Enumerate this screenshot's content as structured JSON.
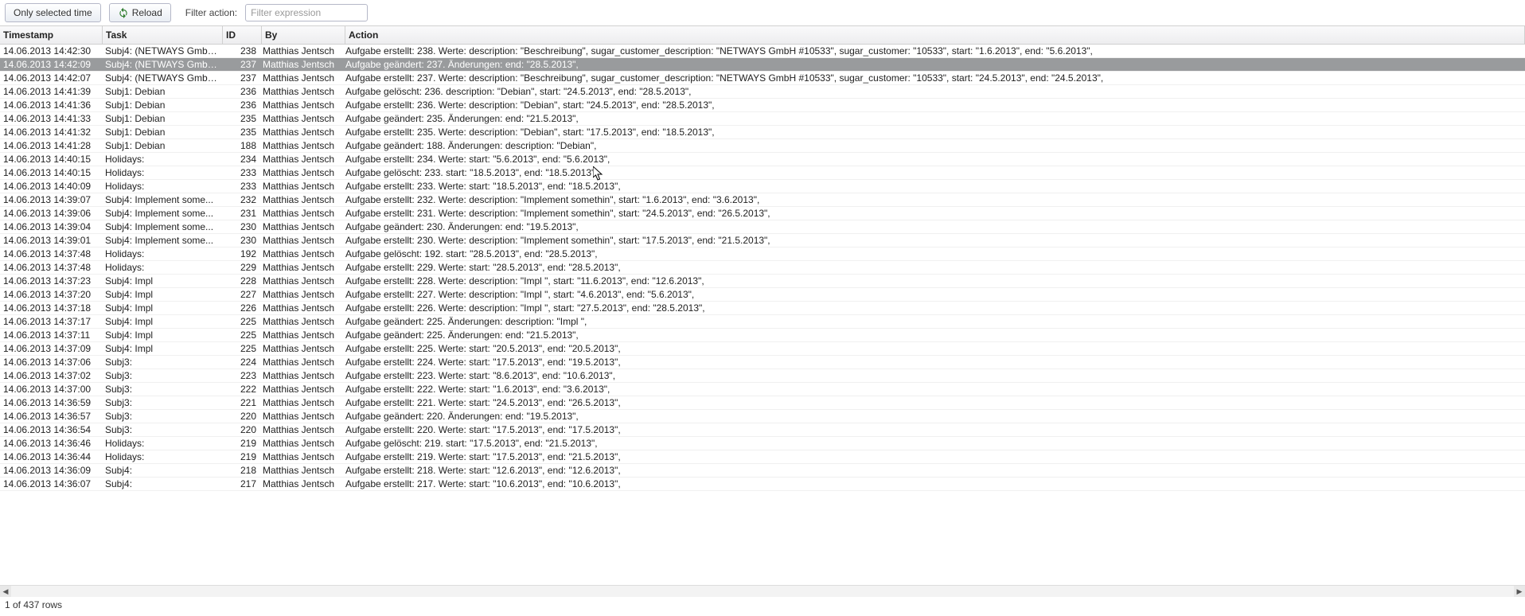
{
  "toolbar": {
    "only_selected_time_label": "Only selected time",
    "reload_label": "Reload",
    "filter_label": "Filter action:",
    "filter_placeholder": "Filter expression"
  },
  "columns": {
    "timestamp": "Timestamp",
    "task": "Task",
    "id": "ID",
    "by": "By",
    "action": "Action"
  },
  "status": {
    "text": "1 of 437 rows"
  },
  "selected_index": 1,
  "rows": [
    {
      "ts": "14.06.2013 14:42:30",
      "task": "Subj4: (NETWAYS GmbH...",
      "id": "238",
      "by": "Matthias Jentsch",
      "action": "Aufgabe erstellt: 238. Werte: description: \"Beschreibung\", sugar_customer_description: \"NETWAYS GmbH #10533\", sugar_customer: \"10533\", start: \"1.6.2013\", end: \"5.6.2013\","
    },
    {
      "ts": "14.06.2013 14:42:09",
      "task": "Subj4: (NETWAYS GmbH...",
      "id": "237",
      "by": "Matthias Jentsch",
      "action": "Aufgabe geändert: 237. Änderungen: end: \"28.5.2013\","
    },
    {
      "ts": "14.06.2013 14:42:07",
      "task": "Subj4: (NETWAYS GmbH...",
      "id": "237",
      "by": "Matthias Jentsch",
      "action": "Aufgabe erstellt: 237. Werte: description: \"Beschreibung\", sugar_customer_description: \"NETWAYS GmbH #10533\", sugar_customer: \"10533\", start: \"24.5.2013\", end: \"24.5.2013\","
    },
    {
      "ts": "14.06.2013 14:41:39",
      "task": "Subj1: Debian",
      "id": "236",
      "by": "Matthias Jentsch",
      "action": "Aufgabe gelöscht: 236. description: \"Debian\", start: \"24.5.2013\", end: \"28.5.2013\","
    },
    {
      "ts": "14.06.2013 14:41:36",
      "task": "Subj1: Debian",
      "id": "236",
      "by": "Matthias Jentsch",
      "action": "Aufgabe erstellt: 236. Werte: description: \"Debian\", start: \"24.5.2013\", end: \"28.5.2013\","
    },
    {
      "ts": "14.06.2013 14:41:33",
      "task": "Subj1: Debian",
      "id": "235",
      "by": "Matthias Jentsch",
      "action": "Aufgabe geändert: 235. Änderungen: end: \"21.5.2013\","
    },
    {
      "ts": "14.06.2013 14:41:32",
      "task": "Subj1: Debian",
      "id": "235",
      "by": "Matthias Jentsch",
      "action": "Aufgabe erstellt: 235. Werte: description: \"Debian\", start: \"17.5.2013\", end: \"18.5.2013\","
    },
    {
      "ts": "14.06.2013 14:41:28",
      "task": "Subj1: Debian",
      "id": "188",
      "by": "Matthias Jentsch",
      "action": "Aufgabe geändert: 188. Änderungen: description: \"Debian\","
    },
    {
      "ts": "14.06.2013 14:40:15",
      "task": "Holidays:",
      "id": "234",
      "by": "Matthias Jentsch",
      "action": "Aufgabe erstellt: 234. Werte: start: \"5.6.2013\", end: \"5.6.2013\","
    },
    {
      "ts": "14.06.2013 14:40:15",
      "task": "Holidays:",
      "id": "233",
      "by": "Matthias Jentsch",
      "action": "Aufgabe gelöscht: 233. start: \"18.5.2013\", end: \"18.5.2013\","
    },
    {
      "ts": "14.06.2013 14:40:09",
      "task": "Holidays:",
      "id": "233",
      "by": "Matthias Jentsch",
      "action": "Aufgabe erstellt: 233. Werte: start: \"18.5.2013\", end: \"18.5.2013\","
    },
    {
      "ts": "14.06.2013 14:39:07",
      "task": "Subj4: Implement some...",
      "id": "232",
      "by": "Matthias Jentsch",
      "action": "Aufgabe erstellt: 232. Werte: description: \"Implement somethin\", start: \"1.6.2013\", end: \"3.6.2013\","
    },
    {
      "ts": "14.06.2013 14:39:06",
      "task": "Subj4: Implement some...",
      "id": "231",
      "by": "Matthias Jentsch",
      "action": "Aufgabe erstellt: 231. Werte: description: \"Implement somethin\", start: \"24.5.2013\", end: \"26.5.2013\","
    },
    {
      "ts": "14.06.2013 14:39:04",
      "task": "Subj4: Implement some...",
      "id": "230",
      "by": "Matthias Jentsch",
      "action": "Aufgabe geändert: 230. Änderungen: end: \"19.5.2013\","
    },
    {
      "ts": "14.06.2013 14:39:01",
      "task": "Subj4: Implement some...",
      "id": "230",
      "by": "Matthias Jentsch",
      "action": "Aufgabe erstellt: 230. Werte: description: \"Implement somethin\", start: \"17.5.2013\", end: \"21.5.2013\","
    },
    {
      "ts": "14.06.2013 14:37:48",
      "task": "Holidays:",
      "id": "192",
      "by": "Matthias Jentsch",
      "action": "Aufgabe gelöscht: 192. start: \"28.5.2013\", end: \"28.5.2013\","
    },
    {
      "ts": "14.06.2013 14:37:48",
      "task": "Holidays:",
      "id": "229",
      "by": "Matthias Jentsch",
      "action": "Aufgabe erstellt: 229. Werte: start: \"28.5.2013\", end: \"28.5.2013\","
    },
    {
      "ts": "14.06.2013 14:37:23",
      "task": "Subj4: Impl",
      "id": "228",
      "by": "Matthias Jentsch",
      "action": "Aufgabe erstellt: 228. Werte: description: \"Impl \", start: \"11.6.2013\", end: \"12.6.2013\","
    },
    {
      "ts": "14.06.2013 14:37:20",
      "task": "Subj4: Impl",
      "id": "227",
      "by": "Matthias Jentsch",
      "action": "Aufgabe erstellt: 227. Werte: description: \"Impl \", start: \"4.6.2013\", end: \"5.6.2013\","
    },
    {
      "ts": "14.06.2013 14:37:18",
      "task": "Subj4: Impl",
      "id": "226",
      "by": "Matthias Jentsch",
      "action": "Aufgabe erstellt: 226. Werte: description: \"Impl \", start: \"27.5.2013\", end: \"28.5.2013\","
    },
    {
      "ts": "14.06.2013 14:37:17",
      "task": "Subj4: Impl",
      "id": "225",
      "by": "Matthias Jentsch",
      "action": "Aufgabe geändert: 225. Änderungen: description: \"Impl \","
    },
    {
      "ts": "14.06.2013 14:37:11",
      "task": "Subj4: Impl",
      "id": "225",
      "by": "Matthias Jentsch",
      "action": "Aufgabe geändert: 225. Änderungen: end: \"21.5.2013\","
    },
    {
      "ts": "14.06.2013 14:37:09",
      "task": "Subj4: Impl",
      "id": "225",
      "by": "Matthias Jentsch",
      "action": "Aufgabe erstellt: 225. Werte: start: \"20.5.2013\", end: \"20.5.2013\","
    },
    {
      "ts": "14.06.2013 14:37:06",
      "task": "Subj3:",
      "id": "224",
      "by": "Matthias Jentsch",
      "action": "Aufgabe erstellt: 224. Werte: start: \"17.5.2013\", end: \"19.5.2013\","
    },
    {
      "ts": "14.06.2013 14:37:02",
      "task": "Subj3:",
      "id": "223",
      "by": "Matthias Jentsch",
      "action": "Aufgabe erstellt: 223. Werte: start: \"8.6.2013\", end: \"10.6.2013\","
    },
    {
      "ts": "14.06.2013 14:37:00",
      "task": "Subj3:",
      "id": "222",
      "by": "Matthias Jentsch",
      "action": "Aufgabe erstellt: 222. Werte: start: \"1.6.2013\", end: \"3.6.2013\","
    },
    {
      "ts": "14.06.2013 14:36:59",
      "task": "Subj3:",
      "id": "221",
      "by": "Matthias Jentsch",
      "action": "Aufgabe erstellt: 221. Werte: start: \"24.5.2013\", end: \"26.5.2013\","
    },
    {
      "ts": "14.06.2013 14:36:57",
      "task": "Subj3:",
      "id": "220",
      "by": "Matthias Jentsch",
      "action": "Aufgabe geändert: 220. Änderungen: end: \"19.5.2013\","
    },
    {
      "ts": "14.06.2013 14:36:54",
      "task": "Subj3:",
      "id": "220",
      "by": "Matthias Jentsch",
      "action": "Aufgabe erstellt: 220. Werte: start: \"17.5.2013\", end: \"17.5.2013\","
    },
    {
      "ts": "14.06.2013 14:36:46",
      "task": "Holidays:",
      "id": "219",
      "by": "Matthias Jentsch",
      "action": "Aufgabe gelöscht: 219. start: \"17.5.2013\", end: \"21.5.2013\","
    },
    {
      "ts": "14.06.2013 14:36:44",
      "task": "Holidays:",
      "id": "219",
      "by": "Matthias Jentsch",
      "action": "Aufgabe erstellt: 219. Werte: start: \"17.5.2013\", end: \"21.5.2013\","
    },
    {
      "ts": "14.06.2013 14:36:09",
      "task": "Subj4:",
      "id": "218",
      "by": "Matthias Jentsch",
      "action": "Aufgabe erstellt: 218. Werte: start: \"12.6.2013\", end: \"12.6.2013\","
    },
    {
      "ts": "14.06.2013 14:36:07",
      "task": "Subj4:",
      "id": "217",
      "by": "Matthias Jentsch",
      "action": "Aufgabe erstellt: 217. Werte: start: \"10.6.2013\", end: \"10.6.2013\","
    }
  ]
}
